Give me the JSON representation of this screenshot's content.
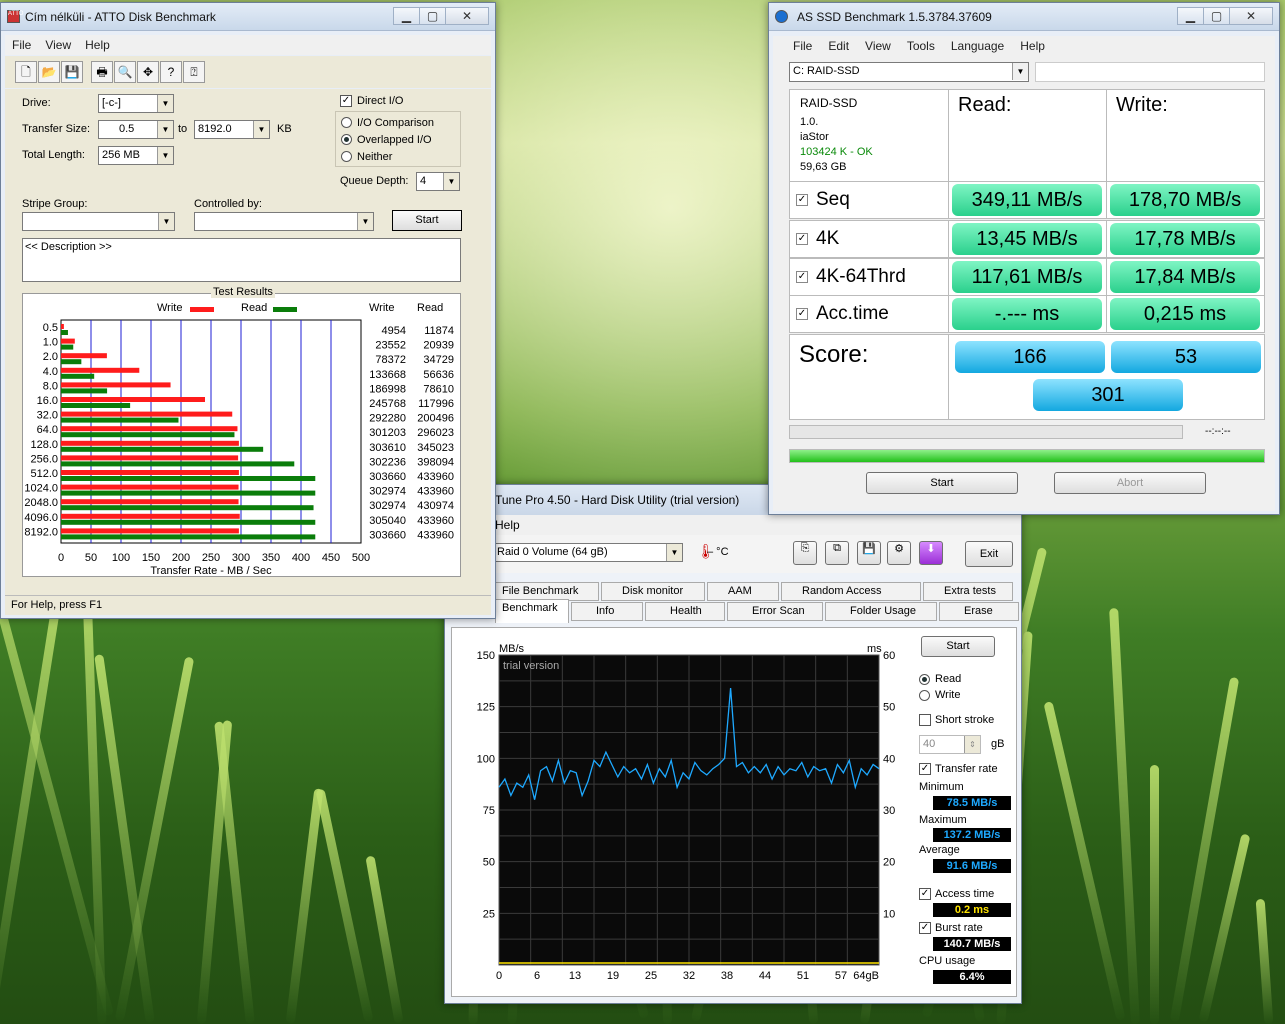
{
  "desktop": {
    "accent": "#5a9a2c"
  },
  "atto": {
    "title": "Cím nélküli - ATTO Disk Benchmark",
    "menu": [
      "File",
      "View",
      "Help"
    ],
    "drive_label": "Drive:",
    "drive_value": "[-c-]",
    "transfer_label": "Transfer Size:",
    "transfer_from": "0.5",
    "to_label": "to",
    "transfer_to": "8192.0",
    "kb_label": "KB",
    "total_label": "Total Length:",
    "total_value": "256 MB",
    "direct_io": "Direct I/O",
    "io_comparison": "I/O Comparison",
    "overlapped": "Overlapped I/O",
    "neither": "Neither",
    "queue_label": "Queue Depth:",
    "queue_value": "4",
    "stripe_label": "Stripe Group:",
    "controlled_label": "Controlled by:",
    "start": "Start",
    "description": "<< Description >>",
    "results_title": "Test Results",
    "legend_write": "Write",
    "legend_read": "Read",
    "col_write": "Write",
    "col_read": "Read",
    "xlabel": "Transfer Rate - MB / Sec",
    "status": "For Help, press F1"
  },
  "chart_data": [
    {
      "type": "bar",
      "title": "Test Results",
      "xlabel": "Transfer Rate - MB / Sec",
      "xlim": [
        0,
        500
      ],
      "xticks": [
        "0",
        "50",
        "100",
        "150",
        "200",
        "250",
        "300",
        "350",
        "400",
        "450",
        "500"
      ],
      "categories": [
        "0.5",
        "1.0",
        "2.0",
        "4.0",
        "8.0",
        "16.0",
        "32.0",
        "64.0",
        "128.0",
        "256.0",
        "512.0",
        "1024.0",
        "2048.0",
        "4096.0",
        "8192.0"
      ],
      "write_kbs": [
        "4954",
        "23552",
        "78372",
        "133668",
        "186998",
        "245768",
        "292280",
        "301203",
        "303610",
        "302236",
        "303660",
        "302974",
        "302974",
        "305040",
        "303660"
      ],
      "read_kbs": [
        "11874",
        "20939",
        "34729",
        "56636",
        "78610",
        "117996",
        "200496",
        "296023",
        "345023",
        "398094",
        "433960",
        "433960",
        "430974",
        "433960",
        "433960"
      ],
      "series": [
        {
          "name": "Write",
          "color": "#ff1c1c",
          "values": [
            4.8,
            23.0,
            76.5,
            130.5,
            182.6,
            240.0,
            285.4,
            294.1,
            296.5,
            295.2,
            296.5,
            295.9,
            295.9,
            297.9,
            296.5
          ]
        },
        {
          "name": "Read",
          "color": "#0a7d0a",
          "values": [
            11.6,
            20.4,
            33.9,
            55.3,
            76.8,
            115.2,
            195.8,
            289.1,
            336.9,
            388.8,
            423.8,
            423.8,
            420.9,
            423.8,
            423.8
          ]
        }
      ]
    },
    {
      "type": "line",
      "title": "",
      "ylabel_left": "MB/s",
      "ylabel_right": "ms",
      "ylim": [
        0,
        150
      ],
      "ylim_right": [
        0,
        60
      ],
      "yticks_left": [
        "150",
        "125",
        "100",
        "75",
        "50",
        "25"
      ],
      "yticks_right": [
        "60",
        "50",
        "40",
        "30",
        "20",
        "10"
      ],
      "xticks": [
        "0",
        "6",
        "13",
        "19",
        "25",
        "32",
        "38",
        "44",
        "51",
        "57",
        "64gB"
      ],
      "xlim": [
        0,
        64
      ],
      "series": [
        {
          "name": "Transfer rate",
          "color": "#1ea9ff",
          "x": [
            0,
            1,
            2,
            3,
            4,
            5,
            6,
            7,
            8,
            9,
            10,
            11,
            12,
            13,
            14,
            15,
            16,
            17,
            18,
            19,
            20,
            21,
            22,
            23,
            24,
            25,
            26,
            27,
            28,
            29,
            30,
            31,
            32,
            33,
            34,
            35,
            36,
            37,
            38,
            39,
            40,
            41,
            42,
            43,
            44,
            45,
            46,
            47,
            48,
            49,
            50,
            51,
            52,
            53,
            54,
            55,
            56,
            57,
            58,
            59,
            60,
            61,
            62,
            63,
            64
          ],
          "y": [
            86,
            90,
            82,
            88,
            86,
            92,
            80,
            94,
            96,
            89,
            99,
            88,
            94,
            93,
            82,
            89,
            99,
            96,
            103,
            97,
            91,
            96,
            93,
            95,
            90,
            97,
            88,
            95,
            91,
            99,
            86,
            93,
            90,
            98,
            94,
            92,
            95,
            97,
            100,
            134,
            96,
            98,
            93,
            96,
            93,
            97,
            90,
            96,
            92,
            95,
            94,
            98,
            91,
            96,
            94,
            95,
            88,
            97,
            93,
            99,
            86,
            95,
            92,
            97,
            95
          ]
        }
      ]
    }
  ],
  "asssd": {
    "title": "AS SSD Benchmark 1.5.3784.37609",
    "menu": [
      "File",
      "Edit",
      "View",
      "Tools",
      "Language",
      "Help"
    ],
    "drive": "C: RAID-SSD",
    "info": {
      "name": "RAID-SSD",
      "version": "1.0.",
      "driver": "iaStor",
      "status": "103424 K - OK",
      "size": "59,63 GB"
    },
    "read_label": "Read:",
    "write_label": "Write:",
    "rows": [
      {
        "name": "Seq",
        "read": "349,11 MB/s",
        "write": "178,70 MB/s"
      },
      {
        "name": "4K",
        "read": "13,45 MB/s",
        "write": "17,78 MB/s"
      },
      {
        "name": "4K-64Thrd",
        "read": "117,61 MB/s",
        "write": "17,84 MB/s"
      },
      {
        "name": "Acc.time",
        "read": "-.--- ms",
        "write": "0,215 ms"
      }
    ],
    "score_label": "Score:",
    "score_read": "166",
    "score_write": "53",
    "score_total": "301",
    "time": "--:--:--",
    "progress": 1.0,
    "start": "Start",
    "abort": "Abort"
  },
  "hdtune": {
    "title": "Tune Pro 4.50 - Hard Disk Utility (trial version)",
    "menu_help": "Help",
    "drive": "Raid 0 Volume (64 gB)",
    "temp": "– °C",
    "exit": "Exit",
    "tabs_top": [
      "File Benchmark",
      "Disk monitor",
      "AAM",
      "Random Access",
      "Extra tests"
    ],
    "tabs_bottom": [
      "Benchmark",
      "Info",
      "Health",
      "Error Scan",
      "Folder Usage",
      "Erase"
    ],
    "watermark": "trial version",
    "start": "Start",
    "read": "Read",
    "write": "Write",
    "short_stroke": "Short stroke",
    "stroke_value": "40",
    "gb": "gB",
    "transfer_rate": "Transfer rate",
    "minimum_label": "Minimum",
    "minimum": "78.5 MB/s",
    "maximum_label": "Maximum",
    "maximum": "137.2 MB/s",
    "average_label": "Average",
    "average": "91.6 MB/s",
    "access_label": "Access time",
    "access": "0.2 ms",
    "burst_label": "Burst rate",
    "burst": "140.7 MB/s",
    "cpu_label": "CPU usage",
    "cpu": "6.4%"
  }
}
